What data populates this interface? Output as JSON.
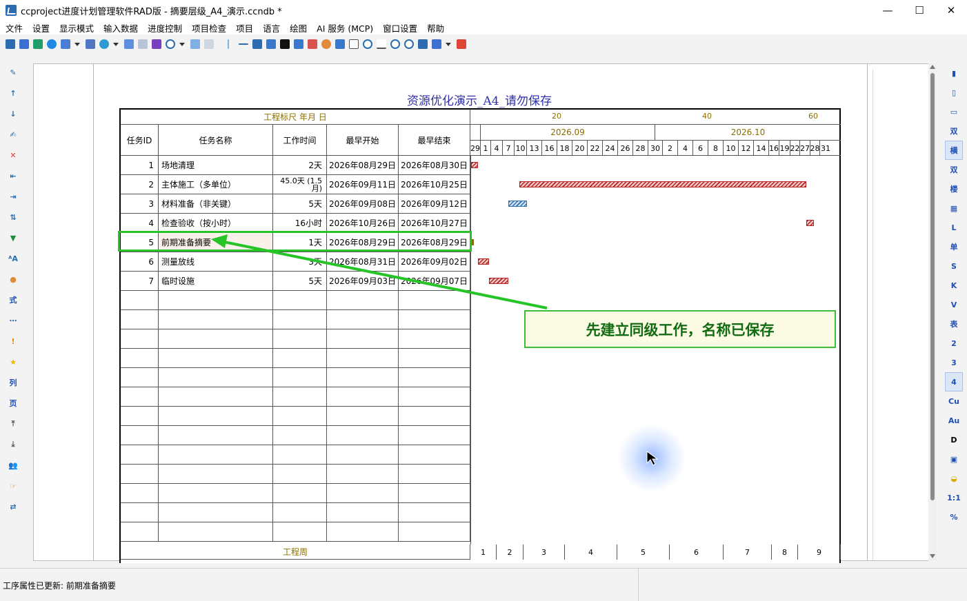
{
  "window": {
    "title": "ccproject进度计划管理软件RAD版 - 摘要层级_A4_演示.ccndb *"
  },
  "menu": [
    "文件",
    "设置",
    "显示模式",
    "输入数据",
    "进度控制",
    "项目检查",
    "项目",
    "语言",
    "绘图",
    "AI 服务 (MCP)",
    "窗口设置",
    "帮助"
  ],
  "right_toolbar": [
    "双",
    "横",
    "双",
    "楼",
    "",
    "L",
    "单",
    "S",
    "K",
    "V",
    "表",
    "2",
    "3",
    "4",
    "Cu",
    "Au",
    "D",
    "",
    "",
    "1:1",
    "%"
  ],
  "left_toolbar": [
    "式",
    "列",
    "页"
  ],
  "chart": {
    "title": "资源优化演示_A4_请勿保存",
    "ruler_label": "工程标尺 年月 日",
    "ruler_ticks": [
      "20",
      "40",
      "60"
    ],
    "months": [
      "2026.09",
      "2026.10"
    ],
    "days": [
      "29",
      "1",
      "4",
      "7",
      "10",
      "13",
      "16",
      "18",
      "20",
      "22",
      "24",
      "26",
      "28",
      "30",
      "2",
      "4",
      "6",
      "8",
      "10",
      "12",
      "14",
      "16",
      "19",
      "22",
      "27",
      "28",
      "31"
    ],
    "footer_label": "工程周",
    "weeks": [
      "1",
      "2",
      "3",
      "4",
      "5",
      "6",
      "7",
      "8",
      "9"
    ]
  },
  "table": {
    "headers": {
      "id": "任务ID",
      "name": "任务名称",
      "duration": "工作时间",
      "start": "最早开始",
      "finish": "最早结束"
    },
    "rows": [
      {
        "id": "1",
        "name": "场地清理",
        "duration": "2天",
        "start": "2026年08月29日",
        "finish": "2026年08月30日"
      },
      {
        "id": "2",
        "name": "主体施工（多单位）",
        "duration": "45.0天 (1.5月)",
        "start": "2026年09月11日",
        "finish": "2026年10月25日"
      },
      {
        "id": "3",
        "name": "材料准备（非关键）",
        "duration": "5天",
        "start": "2026年09月08日",
        "finish": "2026年09月12日"
      },
      {
        "id": "4",
        "name": "检查验收（按小时）",
        "duration": "16小时",
        "start": "2026年10月26日",
        "finish": "2026年10月27日"
      },
      {
        "id": "5",
        "name": "前期准备摘要",
        "duration": "1天",
        "start": "2026年08月29日",
        "finish": "2026年08月29日"
      },
      {
        "id": "6",
        "name": "测量放线",
        "duration": "3天",
        "start": "2026年08月31日",
        "finish": "2026年09月02日"
      },
      {
        "id": "7",
        "name": "临时设施",
        "duration": "5天",
        "start": "2026年09月03日",
        "finish": "2026年09月07日"
      }
    ]
  },
  "callout": {
    "text": "先建立同级工作，名称已保存"
  },
  "status": {
    "message": "工序属性已更新: 前期准备摘要"
  },
  "colors": {
    "title_blue": "#2f2fa8",
    "olive": "#8a6d00",
    "callout_green": "#126b12",
    "highlight": "#27c427",
    "bar_red": "#b22222",
    "bar_blue": "#2f6fb0"
  }
}
